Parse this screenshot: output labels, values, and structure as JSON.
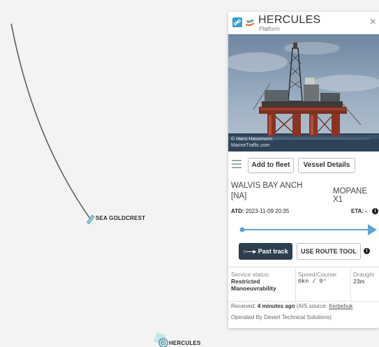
{
  "map": {
    "vessels": [
      {
        "name": "SEA GOLDCREST"
      },
      {
        "name": "HERCULES"
      }
    ]
  },
  "panel": {
    "vessel_name": "HERCULES",
    "vessel_type": "Platform",
    "icons": {
      "link": "link-icon",
      "flag": "flag-icon",
      "close": "close-icon"
    },
    "close_label": "×",
    "photo_credit": [
      "© Hans Hausmann",
      "MarineTraffic.com"
    ],
    "buttons": {
      "add_to_fleet": "Add to fleet",
      "vessel_details": "Vessel Details",
      "past_track": "Past track",
      "use_route_tool": "USE ROUTE TOOL"
    },
    "route": {
      "from": "WALVIS BAY ANCH",
      "from_code": "[NA]",
      "to": "MOPANE X1"
    },
    "atd_label": "ATD:",
    "atd_value": "2023-11-09 20:35",
    "eta_label": "ETA:",
    "eta_value": "-",
    "stats": {
      "status_label": "Service status:",
      "status_value_1": "Restricted",
      "status_value_2": "Manoeuvrability",
      "speed_label": "Speed/Course:",
      "speed_value": "0kn / 0°",
      "draught_label": "Draught",
      "draught_value": "23m"
    },
    "received_prefix": "Received:",
    "received_ago": "4 minutes ago",
    "received_source_prefix": "(AIS source:",
    "received_source": "Kerbehuk",
    "operator": "Operated By Desert Technical Solutions)"
  },
  "colors": {
    "route_blue": "#5ba3d9",
    "dark_button": "#2d3e4f",
    "link_blue": "#2f9fd8"
  }
}
